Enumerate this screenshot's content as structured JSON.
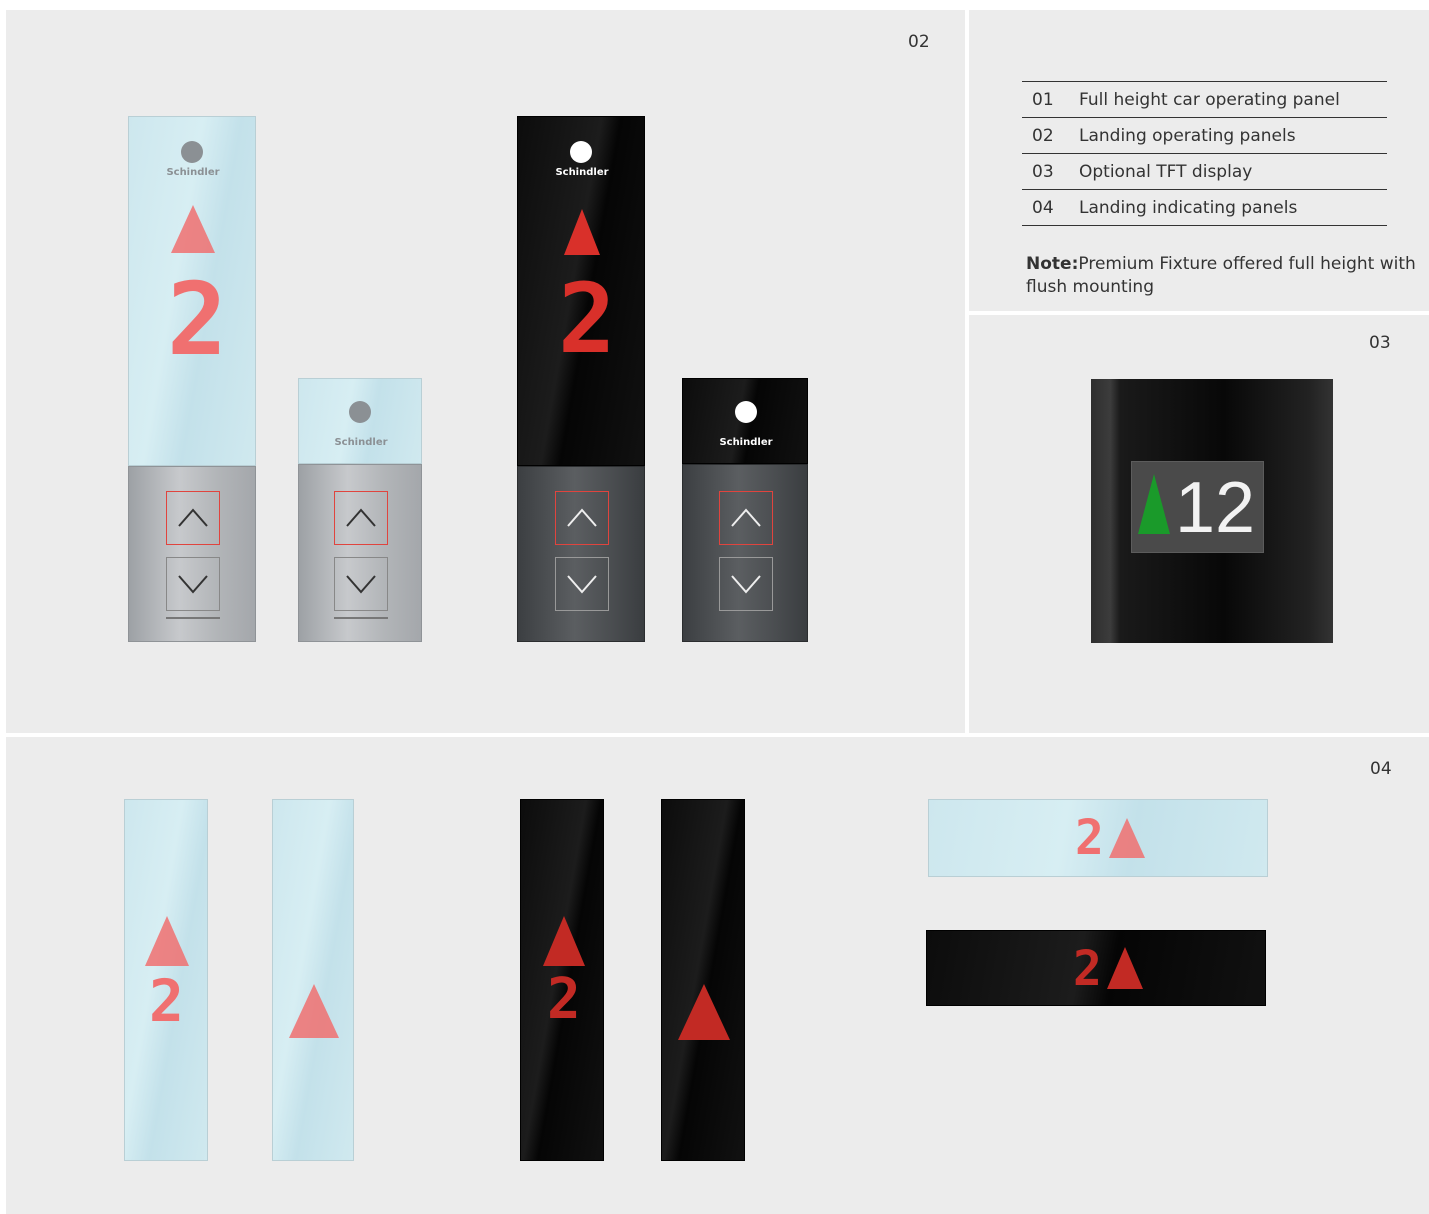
{
  "sections": {
    "panels_02": {
      "number": "02"
    },
    "tft_03": {
      "number": "03"
    },
    "indicators_04": {
      "number": "04"
    }
  },
  "legend": {
    "items": [
      {
        "num": "01",
        "label": "Full height car operating panel"
      },
      {
        "num": "02",
        "label": "Landing operating panels"
      },
      {
        "num": "03",
        "label": "Optional TFT display"
      },
      {
        "num": "04",
        "label": "Landing indicating panels"
      }
    ],
    "note_label": "Note:",
    "note_text": "Premium Fixture offered full height with flush mounting"
  },
  "fixtures": {
    "brand": "Schindler",
    "floor_digit": "2",
    "tft_floor": "12"
  },
  "colors": {
    "led_red": "#f06a6a",
    "tft_arrow": "#1a9a2a",
    "background": "#ececec"
  }
}
